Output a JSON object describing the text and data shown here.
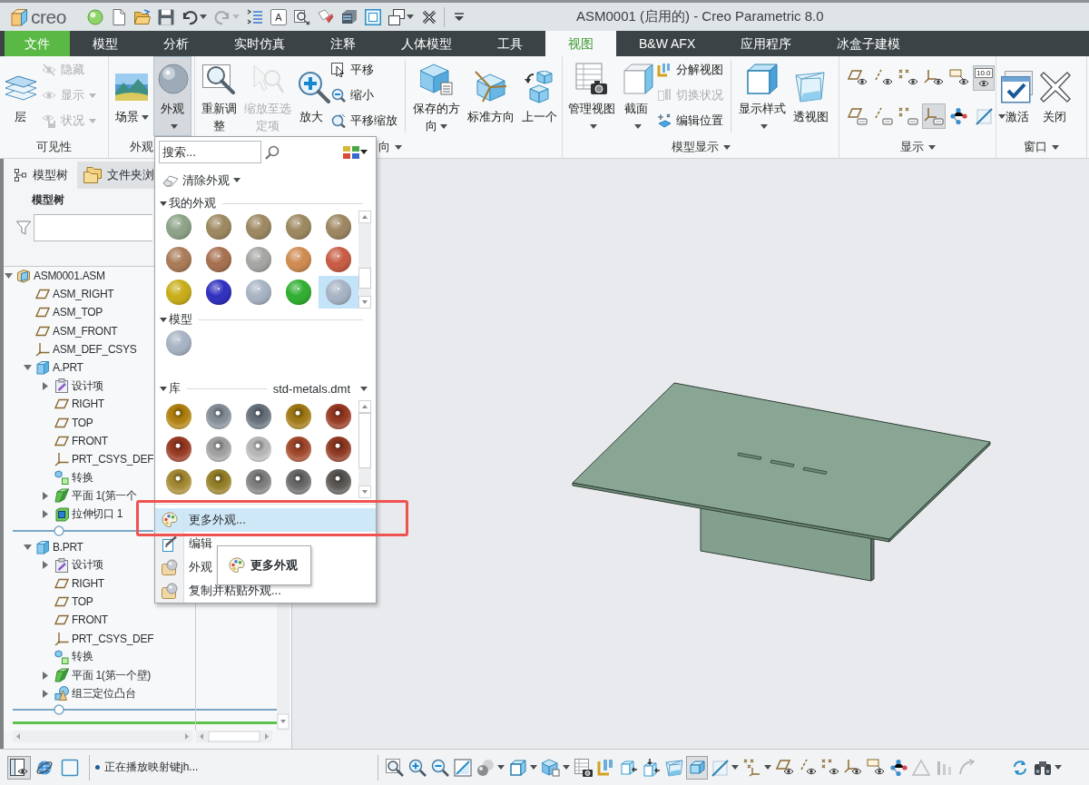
{
  "title_bar": {
    "logo": "creo",
    "title": "ASM0001 (启用的) - Creo Parametric 8.0",
    "quick_access": [
      {
        "disabled": false,
        "menu": false
      },
      {
        "disabled": false,
        "menu": false
      },
      {
        "disabled": false,
        "menu": false
      },
      {
        "disabled": false,
        "menu": false
      },
      {
        "disabled": false,
        "menu": true
      },
      {
        "disabled": true,
        "menu": true
      },
      {
        "disabled": false,
        "menu": false
      },
      {
        "label": "A",
        "disabled": false,
        "menu": false
      },
      {
        "disabled": false,
        "menu": false
      },
      {
        "disabled": false,
        "menu": false
      },
      {
        "disabled": false,
        "menu": false
      },
      {
        "disabled": false,
        "menu": false
      },
      {
        "disabled": false,
        "menu": true
      },
      {
        "disabled": false,
        "menu": false
      },
      {
        "disabled": false,
        "menu": false
      }
    ]
  },
  "ribbon_tabs": [
    {
      "label": "文件",
      "kind": "file",
      "selected": false
    },
    {
      "label": "模型",
      "kind": "tab",
      "selected": false
    },
    {
      "label": "分析",
      "kind": "tab",
      "selected": false
    },
    {
      "label": "实时仿真",
      "kind": "tab",
      "selected": false
    },
    {
      "label": "注释",
      "kind": "tab",
      "selected": false
    },
    {
      "label": "人体模型",
      "kind": "tab",
      "selected": false
    },
    {
      "label": "工具",
      "kind": "tab",
      "selected": false
    },
    {
      "label": "视图",
      "kind": "tab",
      "selected": true
    },
    {
      "label": "B&W AFX",
      "kind": "tab",
      "selected": false
    },
    {
      "label": "应用程序",
      "kind": "tab",
      "selected": false
    },
    {
      "label": "冰盒子建模",
      "kind": "tab",
      "selected": false
    }
  ],
  "ribbon_groups": [
    {
      "label": "可见性",
      "menu": false,
      "sections": [
        [
          {
            "kind": "large",
            "label": "层",
            "menu": false,
            "disabled": false,
            "pressed": false
          },
          {
            "kind": "stack",
            "buttons": [
              {
                "label": "隐藏",
                "menu": false,
                "disabled": true
              },
              {
                "label": "显示",
                "menu": true,
                "disabled": true
              },
              {
                "label": "状况",
                "menu": true,
                "disabled": true
              }
            ]
          }
        ]
      ]
    },
    {
      "label": "外观",
      "menu": false,
      "sections": [
        [
          {
            "kind": "large",
            "label": "场景",
            "menu": true,
            "disabled": false,
            "pressed": false
          },
          {
            "kind": "large",
            "label": "外观",
            "menu": true,
            "disabled": false,
            "pressed": true
          }
        ]
      ]
    },
    {
      "label": "向",
      "menu": true,
      "sections": [
        [
          {
            "kind": "large",
            "label": "重新调整",
            "menu": false,
            "disabled": false,
            "pressed": false
          },
          {
            "kind": "large",
            "label": "缩放至选定项",
            "menu": false,
            "disabled": true,
            "pressed": false
          },
          {
            "kind": "large",
            "label": "放大",
            "menu": false,
            "disabled": false,
            "pressed": false
          },
          {
            "kind": "stack",
            "buttons": [
              {
                "label": "平移",
                "menu": false,
                "disabled": false
              },
              {
                "label": "缩小",
                "menu": false,
                "disabled": false
              },
              {
                "label": "平移缩放",
                "menu": false,
                "disabled": false
              }
            ]
          }
        ],
        [
          {
            "kind": "large",
            "label": "保存的方向",
            "menu": true,
            "disabled": false,
            "pressed": false
          },
          {
            "kind": "large",
            "label": "标准方向",
            "menu": false,
            "disabled": false,
            "pressed": false
          },
          {
            "kind": "large",
            "label": "上一个",
            "menu": false,
            "disabled": false,
            "pressed": false
          }
        ]
      ]
    },
    {
      "label": "模型显示",
      "menu": true,
      "sections": [
        [
          {
            "kind": "large",
            "label": "管理视图",
            "menu": true,
            "disabled": false,
            "pressed": false
          },
          {
            "kind": "large",
            "label": "截面",
            "menu": true,
            "disabled": false,
            "pressed": false
          },
          {
            "kind": "stack",
            "buttons": [
              {
                "label": "分解视图",
                "menu": false,
                "disabled": false
              },
              {
                "label": "切换状况",
                "menu": false,
                "disabled": true
              },
              {
                "label": "编辑位置",
                "menu": false,
                "disabled": false
              }
            ]
          }
        ],
        [
          {
            "kind": "large",
            "label": "显示样式",
            "menu": true,
            "disabled": false,
            "pressed": false
          },
          {
            "kind": "large",
            "label": "透视图",
            "menu": false,
            "disabled": false,
            "pressed": false
          }
        ]
      ]
    },
    {
      "label": "显示",
      "menu": true,
      "sections": [
        [
          {
            "kind": "toggles",
            "toggles": [
              {
                "pressed": false,
                "menu": false
              },
              {
                "pressed": false,
                "menu": false
              },
              {
                "pressed": false,
                "menu": false
              },
              {
                "pressed": false,
                "menu": false
              },
              {
                "pressed": false,
                "menu": false
              },
              {
                "label": "10.0",
                "pressed": true,
                "menu": false
              },
              {
                "pressed": false,
                "menu": false
              },
              {
                "pressed": false,
                "menu": false
              },
              {
                "pressed": false,
                "menu": false
              },
              {
                "pressed": true,
                "menu": false
              },
              {
                "pressed": false,
                "menu": false
              },
              {
                "pressed": false,
                "menu": true
              }
            ]
          }
        ]
      ]
    },
    {
      "label": "窗口",
      "menu": true,
      "sections": [
        [
          {
            "kind": "large",
            "label": "激活",
            "menu": false,
            "disabled": false,
            "pressed": false
          },
          {
            "kind": "large",
            "label": "关闭",
            "menu": false,
            "disabled": false,
            "pressed": false
          }
        ]
      ]
    }
  ],
  "model_tree": {
    "tabs": [
      {
        "label": "模型树",
        "selected": true
      },
      {
        "label": "文件夹浏",
        "selected": false
      }
    ],
    "heading": "模型树",
    "nodes": [
      {
        "label": "ASM0001.ASM",
        "kind": "assembly",
        "expanded": true,
        "children": [
          {
            "label": "ASM_RIGHT",
            "kind": "plane"
          },
          {
            "label": "ASM_TOP",
            "kind": "plane"
          },
          {
            "label": "ASM_FRONT",
            "kind": "plane"
          },
          {
            "label": "ASM_DEF_CSYS",
            "kind": "csys"
          },
          {
            "label": "A.PRT",
            "kind": "part",
            "expanded": true,
            "children": [
              {
                "label": "设计项",
                "kind": "design_items",
                "expanded": false
              },
              {
                "label": "RIGHT",
                "kind": "plane"
              },
              {
                "label": "TOP",
                "kind": "plane"
              },
              {
                "label": "FRONT",
                "kind": "plane"
              },
              {
                "label": "PRT_CSYS_DEF",
                "kind": "csys"
              },
              {
                "label": "转换",
                "kind": "transform"
              },
              {
                "label": "平面 1(第一个",
                "kind": "wall",
                "expanded": false
              },
              {
                "label": "拉伸切口 1",
                "kind": "cut",
                "expanded": false
              },
              {
                "kind": "insert_marker"
              }
            ]
          },
          {
            "label": "B.PRT",
            "kind": "part",
            "expanded": true,
            "children": [
              {
                "label": "设计项",
                "kind": "design_items",
                "expanded": false
              },
              {
                "label": "RIGHT",
                "kind": "plane"
              },
              {
                "label": "TOP",
                "kind": "plane"
              },
              {
                "label": "FRONT",
                "kind": "plane"
              },
              {
                "label": "PRT_CSYS_DEF",
                "kind": "csys"
              },
              {
                "label": "转换",
                "kind": "transform"
              },
              {
                "label": "平面 1(第一个壁)",
                "kind": "wall",
                "expanded": false
              },
              {
                "label": "组三定位凸台",
                "kind": "group",
                "expanded": false
              },
              {
                "kind": "insert_marker"
              }
            ]
          }
        ]
      }
    ]
  },
  "appearance_menu": {
    "search": {
      "placeholder": "搜索..."
    },
    "clear": {
      "label": "清除外观",
      "menu": true
    },
    "sections": [
      {
        "kind": "matte",
        "label": "我的外观",
        "expanded": true,
        "scrollbar": true,
        "swatches": [
          {
            "color": "#8da287",
            "selected": false
          },
          {
            "color": "#9c8760",
            "selected": false
          },
          {
            "color": "#9c8760",
            "selected": false
          },
          {
            "color": "#9c8760",
            "selected": false
          },
          {
            "color": "#9c8560",
            "selected": false
          },
          {
            "color": "#a97a57",
            "selected": false
          },
          {
            "color": "#a66f4f",
            "selected": false
          },
          {
            "color": "#a5a5a3",
            "selected": false
          },
          {
            "color": "#cf8a50",
            "selected": false
          },
          {
            "color": "#c75b43",
            "selected": false
          },
          {
            "color": "#c8ad18",
            "selected": false
          },
          {
            "color": "#2f2fbf",
            "selected": false
          },
          {
            "color": "#a7b3c3",
            "selected": false
          },
          {
            "color": "#2fae2f",
            "selected": false
          },
          {
            "color": "#a7b3c3",
            "selected": true
          }
        ]
      },
      {
        "kind": "matte",
        "label": "模型",
        "expanded": true,
        "scrollbar": false,
        "swatches": [
          {
            "color": "#a7b3c3",
            "selected": false
          }
        ]
      },
      {
        "kind": "metal",
        "label": "库",
        "library": "std-metals.dmt",
        "expanded": true,
        "scrollbar": true,
        "swatches": [
          {
            "color": "#b8860e",
            "selected": false
          },
          {
            "color": "#8a939e",
            "selected": false
          },
          {
            "color": "#6b7580",
            "selected": false
          },
          {
            "color": "#a77d14",
            "selected": false
          },
          {
            "color": "#9c3a22",
            "selected": false
          },
          {
            "color": "#9e3b22",
            "selected": false
          },
          {
            "color": "#a8a8a8",
            "selected": false
          },
          {
            "color": "#c0c0c0",
            "selected": false
          },
          {
            "color": "#a84a2c",
            "selected": false
          },
          {
            "color": "#953a22",
            "selected": false
          },
          {
            "color": "#ab8f34",
            "selected": false
          },
          {
            "color": "#9c8428",
            "selected": false
          },
          {
            "color": "#858585",
            "selected": false
          },
          {
            "color": "#6e6e6e",
            "selected": false
          },
          {
            "color": "#5e5a56",
            "selected": false
          }
        ]
      }
    ],
    "items": [
      {
        "label": "更多外观...",
        "highlighted": true,
        "callout": true
      },
      {
        "label": "编辑",
        "highlighted": false,
        "callout": false
      },
      {
        "label": "外观",
        "highlighted": false,
        "callout": false
      },
      {
        "label": "复制并粘贴外观...",
        "highlighted": false,
        "callout": false
      }
    ],
    "tooltip": {
      "label": "更多外观"
    }
  },
  "status_bar": {
    "tools": [
      {
        "pressed": true
      },
      {
        "pressed": false
      },
      {
        "pressed": false
      }
    ],
    "message": "正在播放映射键jh...",
    "graphics_toolbar": [
      {
        "pressed": false,
        "menu": false
      },
      {
        "pressed": false,
        "menu": false
      },
      {
        "pressed": false,
        "menu": false
      },
      {
        "pressed": false,
        "menu": false
      },
      {
        "pressed": false,
        "menu": true
      },
      {
        "pressed": false,
        "menu": true
      },
      {
        "pressed": false,
        "menu": true
      },
      {
        "pressed": false,
        "menu": false
      },
      {
        "pressed": false,
        "menu": false
      },
      {
        "pressed": false,
        "menu": false
      },
      {
        "pressed": false,
        "menu": false
      },
      {
        "pressed": false,
        "menu": false
      },
      {
        "pressed": true,
        "menu": false
      },
      {
        "pressed": false,
        "menu": true
      },
      {
        "pressed": false,
        "menu": true
      },
      {
        "pressed": false,
        "menu": false
      },
      {
        "pressed": false,
        "menu": false
      },
      {
        "pressed": false,
        "menu": false
      },
      {
        "pressed": false,
        "menu": false
      },
      {
        "pressed": false,
        "menu": false
      },
      {
        "pressed": false,
        "menu": false
      },
      {
        "pressed": false,
        "menu": false
      },
      {
        "pressed": false,
        "menu": false
      },
      {
        "pressed": false,
        "menu": false
      },
      {
        "pressed": false,
        "menu": false
      },
      {
        "pressed": false,
        "menu": true
      }
    ]
  }
}
